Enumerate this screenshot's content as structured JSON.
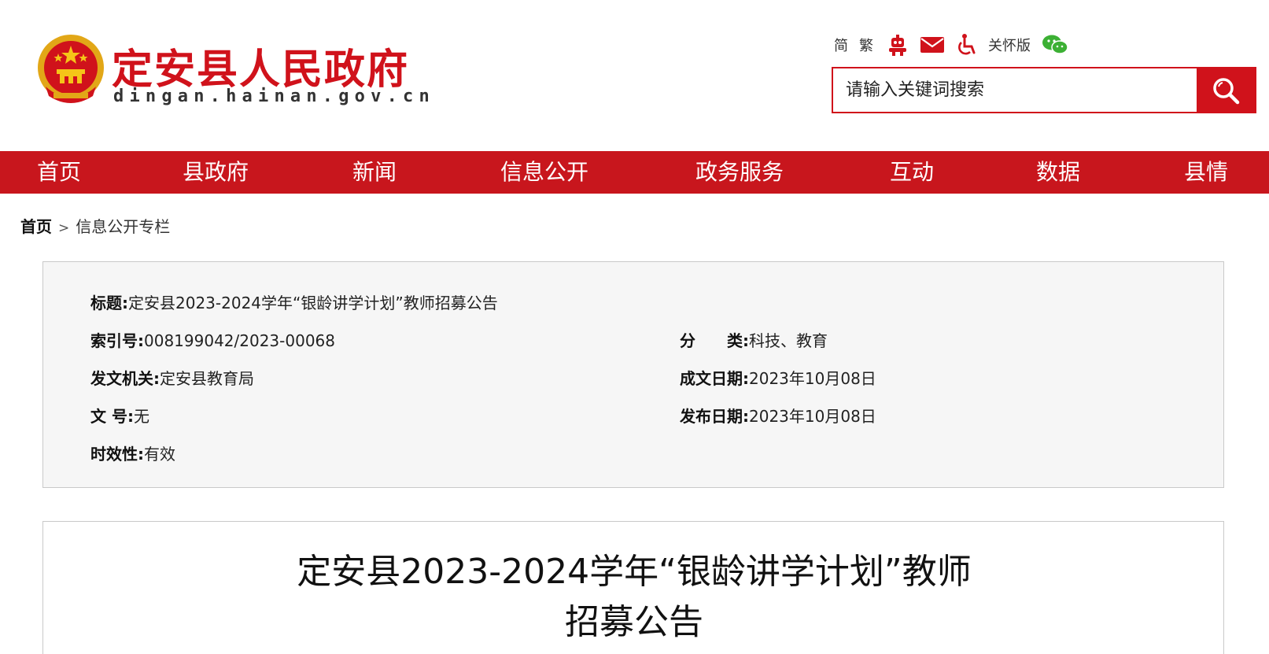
{
  "site": {
    "title": "定安县人民政府",
    "domain": "dingan.hainan.gov.cn",
    "brand_color": "#d0121b"
  },
  "toolbar": {
    "simplified": "简",
    "traditional": "繁",
    "robot_icon": "robot-icon",
    "mail_icon": "mail-icon",
    "accessibility_icon": "wheelchair-icon",
    "care_version": "关怀版",
    "wechat_icon": "wechat-icon"
  },
  "search": {
    "placeholder": "请输入关键词搜索",
    "button_icon": "search-icon"
  },
  "nav": {
    "items": [
      "首页",
      "县政府",
      "新闻",
      "信息公开",
      "政务服务",
      "互动",
      "数据",
      "县情"
    ]
  },
  "breadcrumb": {
    "home": "首页",
    "separator": ">",
    "current": "信息公开专栏"
  },
  "meta": {
    "title_label": "标题:",
    "title_value": "定安县2023-2024学年“银龄讲学计划”教师招募公告",
    "index_label": "索引号:",
    "index_value": "008199042/2023-00068",
    "category_label": "分　　类:",
    "category_value": "科技、教育",
    "issuer_label": "发文机关:",
    "issuer_value": "定安县教育局",
    "created_label": "成文日期:",
    "created_value": "2023年10月08日",
    "docno_label": "文 号:",
    "docno_value": "无",
    "published_label": "发布日期:",
    "published_value": "2023年10月08日",
    "validity_label": "时效性:",
    "validity_value": "有效"
  },
  "article": {
    "title_line1": "定安县2023-2024学年“银龄讲学计划”教师",
    "title_line2": "招募公告"
  }
}
